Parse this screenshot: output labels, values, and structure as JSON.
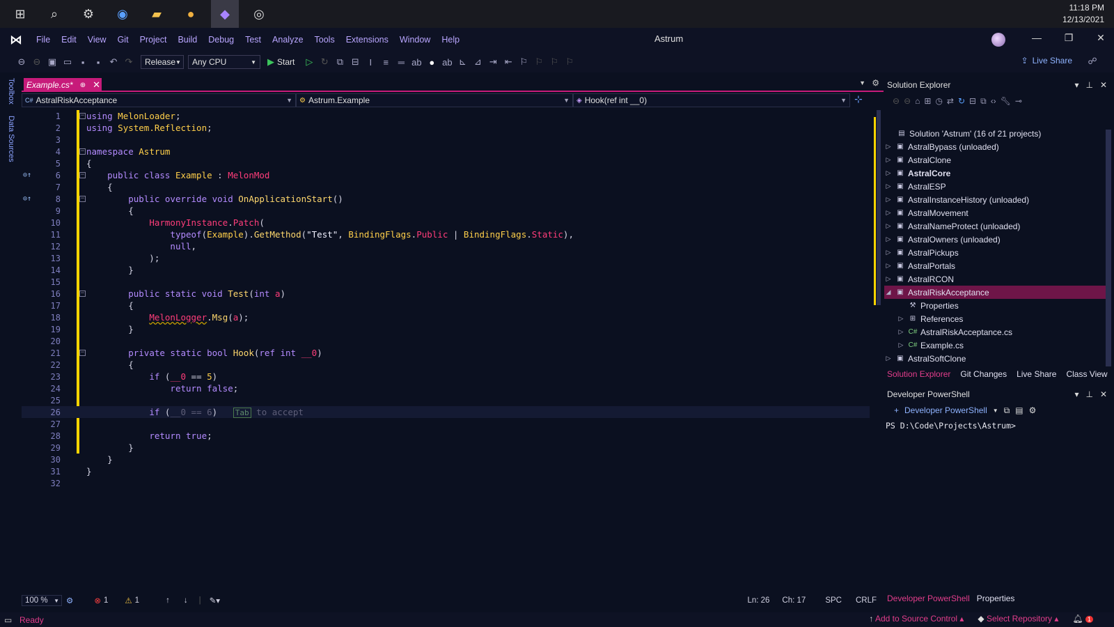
{
  "taskbar": {
    "icons": [
      "start-icon",
      "search-icon",
      "steam-icon",
      "firefox-icon",
      "file-explorer-icon",
      "discord-icon",
      "visual-studio-icon",
      "obs-icon"
    ],
    "time": "11:18 PM",
    "date": "12/13/2021"
  },
  "menubar": {
    "items": [
      "File",
      "Edit",
      "View",
      "Git",
      "Project",
      "Build",
      "Debug",
      "Test",
      "Analyze",
      "Tools",
      "Extensions",
      "Window",
      "Help"
    ],
    "title": "Astrum"
  },
  "toolbar": {
    "config": "Release",
    "platform": "Any CPU",
    "start_label": "Start",
    "live_share": "Live Share"
  },
  "left_tabs": [
    "Toolbox",
    "Data Sources"
  ],
  "editor": {
    "tab_label": "Example.cs*",
    "nav_project": "AstralRiskAcceptance",
    "nav_class": "Astrum.Example",
    "nav_member": "Hook(ref int __0)",
    "lines": [
      {
        "n": "1",
        "text": "using MelonLoader;"
      },
      {
        "n": "2",
        "text": "using System.Reflection;"
      },
      {
        "n": "3",
        "text": ""
      },
      {
        "n": "4",
        "text": "namespace Astrum"
      },
      {
        "n": "5",
        "text": "{"
      },
      {
        "n": "6",
        "text": "    public class Example : MelonMod"
      },
      {
        "n": "7",
        "text": "    {"
      },
      {
        "n": "8",
        "text": "        public override void OnApplicationStart()"
      },
      {
        "n": "9",
        "text": "        {"
      },
      {
        "n": "10",
        "text": "            HarmonyInstance.Patch("
      },
      {
        "n": "11",
        "text": "                typeof(Example).GetMethod(\"Test\", BindingFlags.Public | BindingFlags.Static),"
      },
      {
        "n": "12",
        "text": "                null,"
      },
      {
        "n": "13",
        "text": "            );"
      },
      {
        "n": "14",
        "text": "        }"
      },
      {
        "n": "15",
        "text": ""
      },
      {
        "n": "16",
        "text": "        public static void Test(int a)"
      },
      {
        "n": "17",
        "text": "        {"
      },
      {
        "n": "18",
        "text": "            MelonLogger.Msg(a);"
      },
      {
        "n": "19",
        "text": "        }"
      },
      {
        "n": "20",
        "text": ""
      },
      {
        "n": "21",
        "text": "        private static bool Hook(ref int __0)"
      },
      {
        "n": "22",
        "text": "        {"
      },
      {
        "n": "23",
        "text": "            if (__0 == 5)"
      },
      {
        "n": "24",
        "text": "                return false;"
      },
      {
        "n": "25",
        "text": ""
      },
      {
        "n": "26",
        "text": "            if (__0 == 6)"
      },
      {
        "n": "27",
        "text": ""
      },
      {
        "n": "28",
        "text": "            return true;"
      },
      {
        "n": "29",
        "text": "        }"
      },
      {
        "n": "30",
        "text": "    }"
      },
      {
        "n": "31",
        "text": "}"
      },
      {
        "n": "32",
        "text": ""
      }
    ],
    "hint_key": "Tab",
    "hint_text": "to accept"
  },
  "editor_status": {
    "zoom": "100 %",
    "errors": "1",
    "warnings": "1",
    "ln": "Ln: 26",
    "ch": "Ch: 17",
    "spc": "SPC",
    "crlf": "CRLF"
  },
  "solution_explorer": {
    "title": "Solution Explorer",
    "solution": "Solution 'Astrum' (16 of 21 projects)",
    "items": [
      {
        "label": "AstralBypass (unloaded)",
        "icon": "unloaded-project-icon"
      },
      {
        "label": "AstralClone",
        "icon": "csharp-project-icon"
      },
      {
        "label": "AstralCore",
        "icon": "csharp-project-icon"
      },
      {
        "label": "AstralESP",
        "icon": "csharp-project-icon"
      },
      {
        "label": "AstralInstanceHistory (unloaded)",
        "icon": "unloaded-project-icon"
      },
      {
        "label": "AstralMovement",
        "icon": "csharp-project-icon"
      },
      {
        "label": "AstralNameProtect (unloaded)",
        "icon": "unloaded-project-icon"
      },
      {
        "label": "AstralOwners (unloaded)",
        "icon": "unloaded-project-icon"
      },
      {
        "label": "AstralPickups",
        "icon": "csharp-project-icon"
      },
      {
        "label": "AstralPortals",
        "icon": "csharp-project-icon"
      },
      {
        "label": "AstralRCON",
        "icon": "csharp-project-icon"
      },
      {
        "label": "AstralRiskAcceptance",
        "icon": "csharp-project-icon"
      },
      {
        "label": "Properties",
        "icon": "wrench-icon"
      },
      {
        "label": "References",
        "icon": "references-icon"
      },
      {
        "label": "AstralRiskAcceptance.cs",
        "icon": "csharp-file-icon"
      },
      {
        "label": "Example.cs",
        "icon": "csharp-file-icon"
      },
      {
        "label": "AstralSoftClone",
        "icon": "csharp-project-icon"
      }
    ],
    "tabs": [
      "Solution Explorer",
      "Git Changes",
      "Live Share",
      "Class View"
    ]
  },
  "developer_powershell": {
    "title": "Developer PowerShell",
    "new_label": "Developer PowerShell",
    "prompt": "PS D:\\Code\\Projects\\Astrum>",
    "tabs": [
      "Developer PowerShell",
      "Properties"
    ]
  },
  "status": {
    "ready": "Ready",
    "source_control": "Add to Source Control",
    "repository": "Select Repository",
    "notifications": "1"
  },
  "colors": {
    "accent": "#c71b7a",
    "status_accent": "#e33d8b",
    "keyword": "#b48bff",
    "type": "#ffcf4a"
  }
}
